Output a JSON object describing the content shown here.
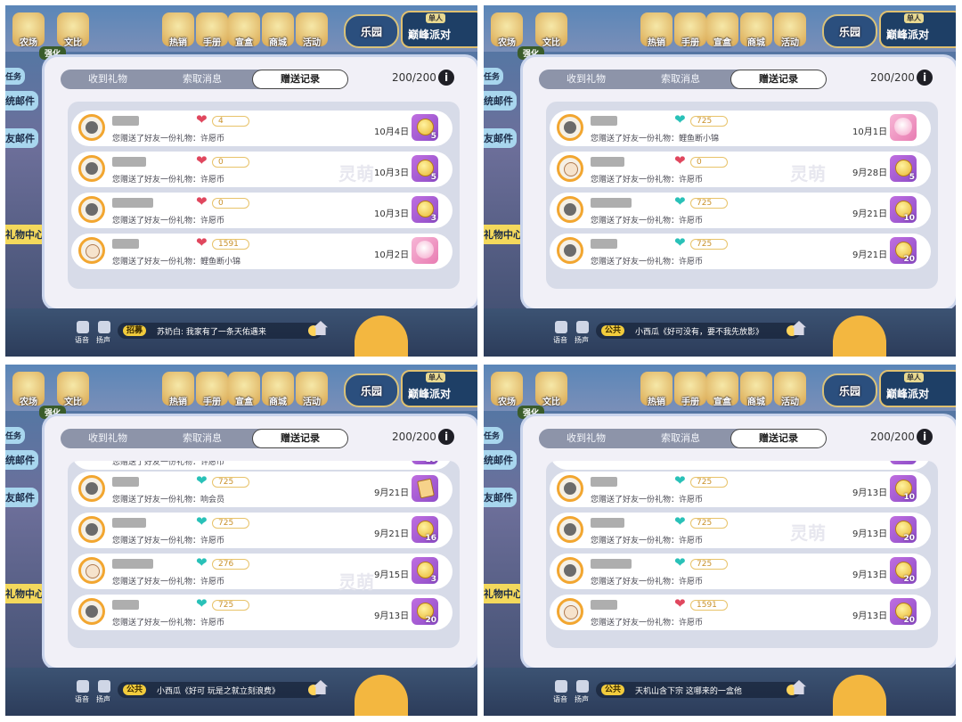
{
  "hud": {
    "farm": "农场",
    "duel": "文比",
    "hot": "热销",
    "manual": "手册",
    "bag": "宣盒",
    "shop": "商城",
    "event": "活动",
    "park": "乐园",
    "peak_tag": "单人",
    "peak": "巅峰派对",
    "strengthen": "强化"
  },
  "sidebar": {
    "task": "任务",
    "system_mail": "统邮件",
    "friend_mail": "友邮件",
    "gift_center": "礼物中心"
  },
  "dialog": {
    "tab_received": "收到礼物",
    "tab_request": "索取消息",
    "tab_sent": "赠送记录",
    "count": "200/200"
  },
  "bottom": {
    "voice": "语音",
    "speaker": "扬声"
  },
  "watermark": "灵萌",
  "screens": [
    {
      "chat": {
        "channel": "招募",
        "text": "苏奶白: 我家有了一条天佑遇来"
      },
      "rows": [
        {
          "heart": "red",
          "value": "4",
          "message": "您赠送了好友一份礼物：许愿币",
          "date": "10月4日",
          "gift": "coin",
          "qty": "5",
          "avatar": "dark"
        },
        {
          "heart": "red",
          "value": "0",
          "message": "您赠送了好友一份礼物：许愿币",
          "date": "10月3日",
          "gift": "coin",
          "qty": "5",
          "avatar": "dark"
        },
        {
          "heart": "red",
          "value": "0",
          "message": "您赠送了好友一份礼物：许愿币",
          "date": "10月3日",
          "gift": "coin",
          "qty": "3",
          "avatar": "dark"
        },
        {
          "heart": "red",
          "value": "1591",
          "message": "您赠送了好友一份礼物：鲤鱼断小锦",
          "date": "10月2日",
          "gift": "fish",
          "qty": "",
          "avatar": "light"
        }
      ]
    },
    {
      "chat": {
        "channel": "公共",
        "text": "小西瓜《好可没有，要不我先放影》"
      },
      "rows": [
        {
          "heart": "teal",
          "value": "725",
          "message": "您赠送了好友一份礼物：鲤鱼断小锦",
          "date": "10月1日",
          "gift": "fish",
          "qty": "",
          "avatar": "dark"
        },
        {
          "heart": "red",
          "value": "0",
          "message": "您赠送了好友一份礼物：许愿币",
          "date": "9月28日",
          "gift": "coin",
          "qty": "5",
          "avatar": "light"
        },
        {
          "heart": "teal",
          "value": "725",
          "message": "您赠送了好友一份礼物：许愿币",
          "date": "9月21日",
          "gift": "coin",
          "qty": "10",
          "avatar": "dark"
        },
        {
          "heart": "teal",
          "value": "725",
          "message": "您赠送了好友一份礼物：许愿币",
          "date": "9月21日",
          "gift": "coin",
          "qty": "20",
          "avatar": "dark"
        }
      ]
    },
    {
      "chat": {
        "channel": "公共",
        "text": "小西瓜《好可 玩是之就立刻浪费》"
      },
      "partial": {
        "message": "您赠送了好友一份礼物：许愿币",
        "qty": "10"
      },
      "rows": [
        {
          "heart": "teal",
          "value": "725",
          "message": "您赠送了好友一份礼物：响会员",
          "date": "9月21日",
          "gift": "card",
          "qty": "",
          "avatar": "dark"
        },
        {
          "heart": "teal",
          "value": "725",
          "message": "您赠送了好友一份礼物：许愿币",
          "date": "9月21日",
          "gift": "coin",
          "qty": "16",
          "avatar": "dark"
        },
        {
          "heart": "teal",
          "value": "276",
          "message": "您赠送了好友一份礼物：许愿币",
          "date": "9月15日",
          "gift": "coin",
          "qty": "3",
          "avatar": "light"
        },
        {
          "heart": "teal",
          "value": "725",
          "message": "您赠送了好友一份礼物：许愿币",
          "date": "9月13日",
          "gift": "coin",
          "qty": "20",
          "avatar": "dark"
        }
      ]
    },
    {
      "chat": {
        "channel": "公共",
        "text": "天机山含下宗 这哪来的一盒他"
      },
      "partial": {
        "message": "",
        "qty": ""
      },
      "rows": [
        {
          "heart": "teal",
          "value": "725",
          "message": "您赠送了好友一份礼物：许愿币",
          "date": "9月13日",
          "gift": "coin",
          "qty": "10",
          "avatar": "dark"
        },
        {
          "heart": "teal",
          "value": "725",
          "message": "您赠送了好友一份礼物：许愿币",
          "date": "9月13日",
          "gift": "coin",
          "qty": "20",
          "avatar": "dark"
        },
        {
          "heart": "teal",
          "value": "725",
          "message": "您赠送了好友一份礼物：许愿币",
          "date": "9月13日",
          "gift": "coin",
          "qty": "20",
          "avatar": "dark"
        },
        {
          "heart": "red",
          "value": "1591",
          "message": "您赠送了好友一份礼物：许愿币",
          "date": "9月13日",
          "gift": "coin",
          "qty": "20",
          "avatar": "light"
        }
      ]
    }
  ]
}
